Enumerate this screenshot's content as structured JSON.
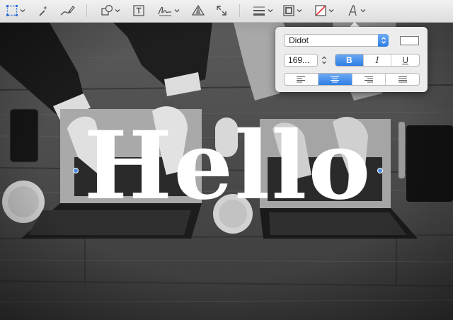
{
  "toolbar": {
    "tools": [
      {
        "name": "selection-tool",
        "icon": "dotted-rectangle-icon"
      },
      {
        "name": "instant-alpha-tool",
        "icon": "magic-wand-icon"
      },
      {
        "name": "sketch-tool",
        "icon": "pen-stroke-icon"
      },
      {
        "name": "shapes-tool",
        "icon": "shapes-icon"
      },
      {
        "name": "text-tool",
        "icon": "text-box-icon"
      },
      {
        "name": "sign-tool",
        "icon": "signature-icon"
      },
      {
        "name": "adjust-color-tool",
        "icon": "prism-icon"
      },
      {
        "name": "adjust-size-tool",
        "icon": "resize-arrows-icon"
      },
      {
        "name": "shape-style-tool",
        "icon": "lines-icon"
      },
      {
        "name": "border-color-tool",
        "icon": "border-square-icon"
      },
      {
        "name": "fill-color-tool",
        "icon": "fill-slash-icon"
      },
      {
        "name": "text-style-tool",
        "icon": "text-style-A-icon"
      }
    ],
    "accent": "#2f7ee4"
  },
  "canvas": {
    "text": "Hello",
    "text_color": "#ffffff"
  },
  "font_panel": {
    "font_family": "Didot",
    "font_size": "169...",
    "text_color": "#ffffff",
    "bold_label": "B",
    "italic_label": "I",
    "underline_label": "U",
    "bold_on": true,
    "alignment_selected": "center",
    "alignments": [
      "left",
      "center",
      "right",
      "justify"
    ]
  }
}
